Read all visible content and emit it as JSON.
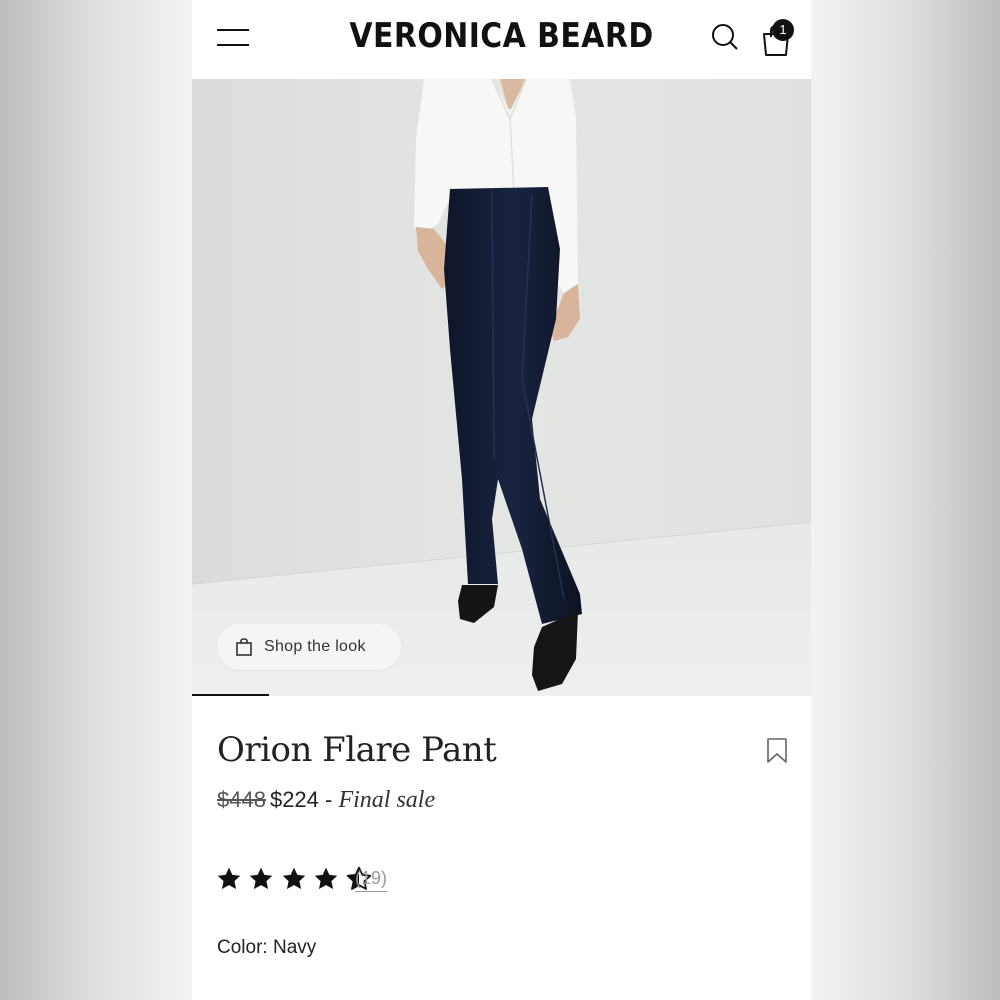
{
  "header": {
    "brand": "VERONICA BEARD",
    "cart_count": "1"
  },
  "hero": {
    "shop_the_look_label": "Shop the look"
  },
  "product": {
    "name": "Orion Flare Pant",
    "original_price": "$448",
    "sale_price": "$224",
    "sale_separator": " - ",
    "sale_note": "Final sale",
    "rating": 4.5,
    "review_count": "(19)",
    "color_label": "Color:",
    "color_value": "Navy"
  },
  "colors": {
    "pant_navy": "#141c33",
    "text": "#222222"
  }
}
